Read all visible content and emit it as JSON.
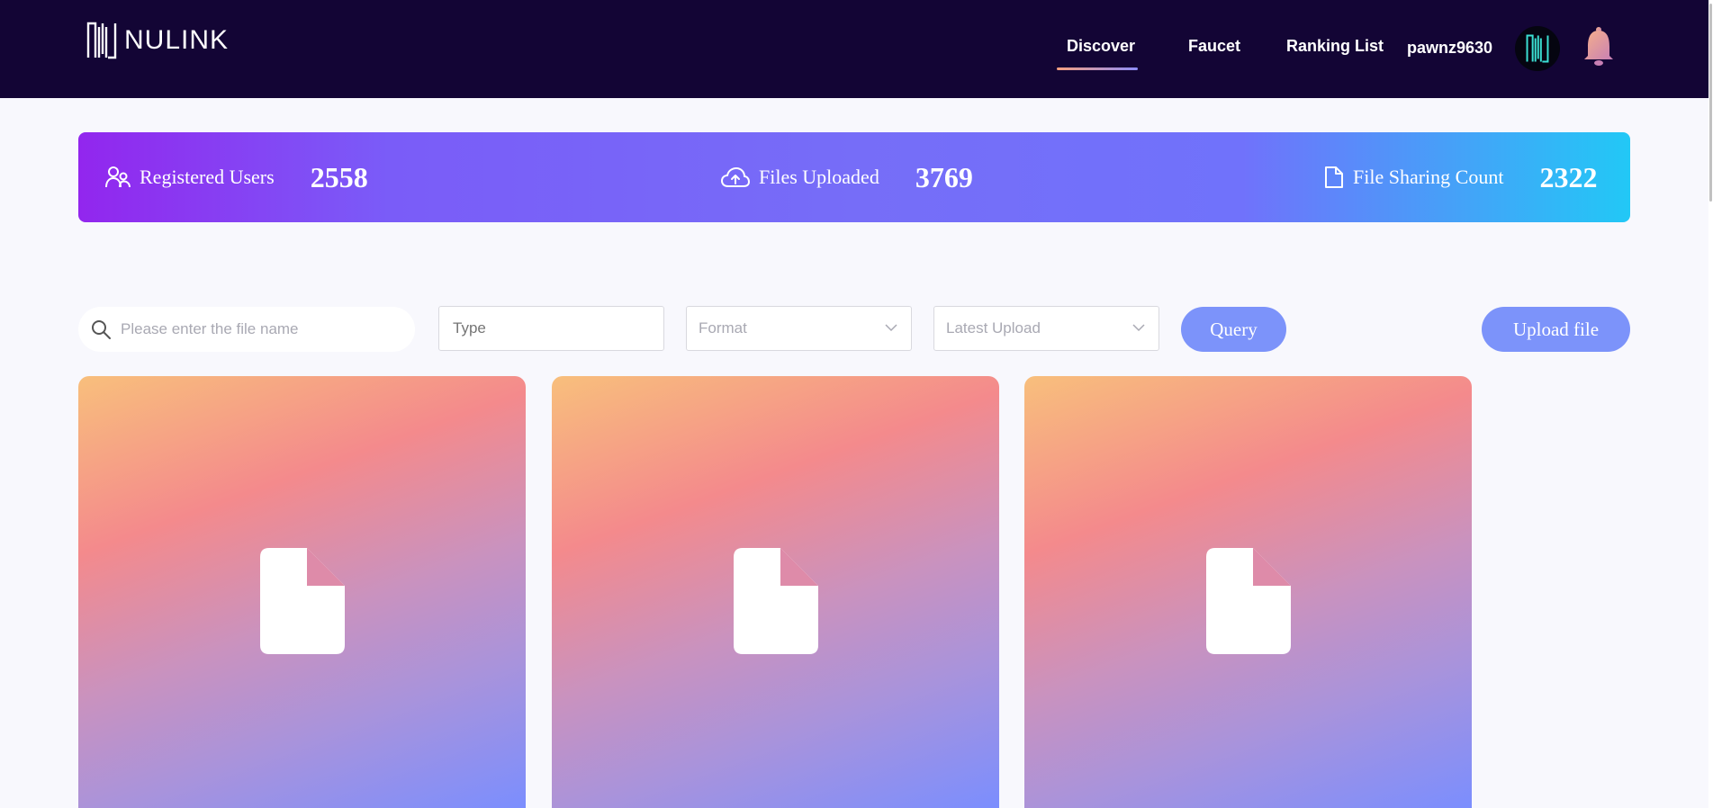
{
  "header": {
    "logo_text": "NULINK",
    "nav": [
      {
        "label": "Discover",
        "active": true
      },
      {
        "label": "Faucet",
        "active": false
      },
      {
        "label": "Ranking List",
        "active": false
      }
    ],
    "username": "pawnz9630",
    "avatar_icon": "nulink-logo-icon",
    "notification_icon": "bell-icon"
  },
  "stats": [
    {
      "icon": "users-icon",
      "label": "Registered Users",
      "value": "2558"
    },
    {
      "icon": "cloud-upload-icon",
      "label": "Files Uploaded",
      "value": "3769"
    },
    {
      "icon": "file-icon",
      "label": "File Sharing Count",
      "value": "2322"
    }
  ],
  "filters": {
    "search_placeholder": "Please enter the file name",
    "type_placeholder": "Type",
    "format_selected": "Format",
    "sort_selected": "Latest Upload",
    "query_label": "Query",
    "upload_label": "Upload file"
  },
  "files": [
    {
      "icon": "file-icon"
    },
    {
      "icon": "file-icon"
    },
    {
      "icon": "file-icon"
    }
  ],
  "colors": {
    "header_bg": "#130535",
    "accent": "#7c93fa",
    "banner_start": "#9226ee",
    "banner_end": "#22c8f6"
  }
}
